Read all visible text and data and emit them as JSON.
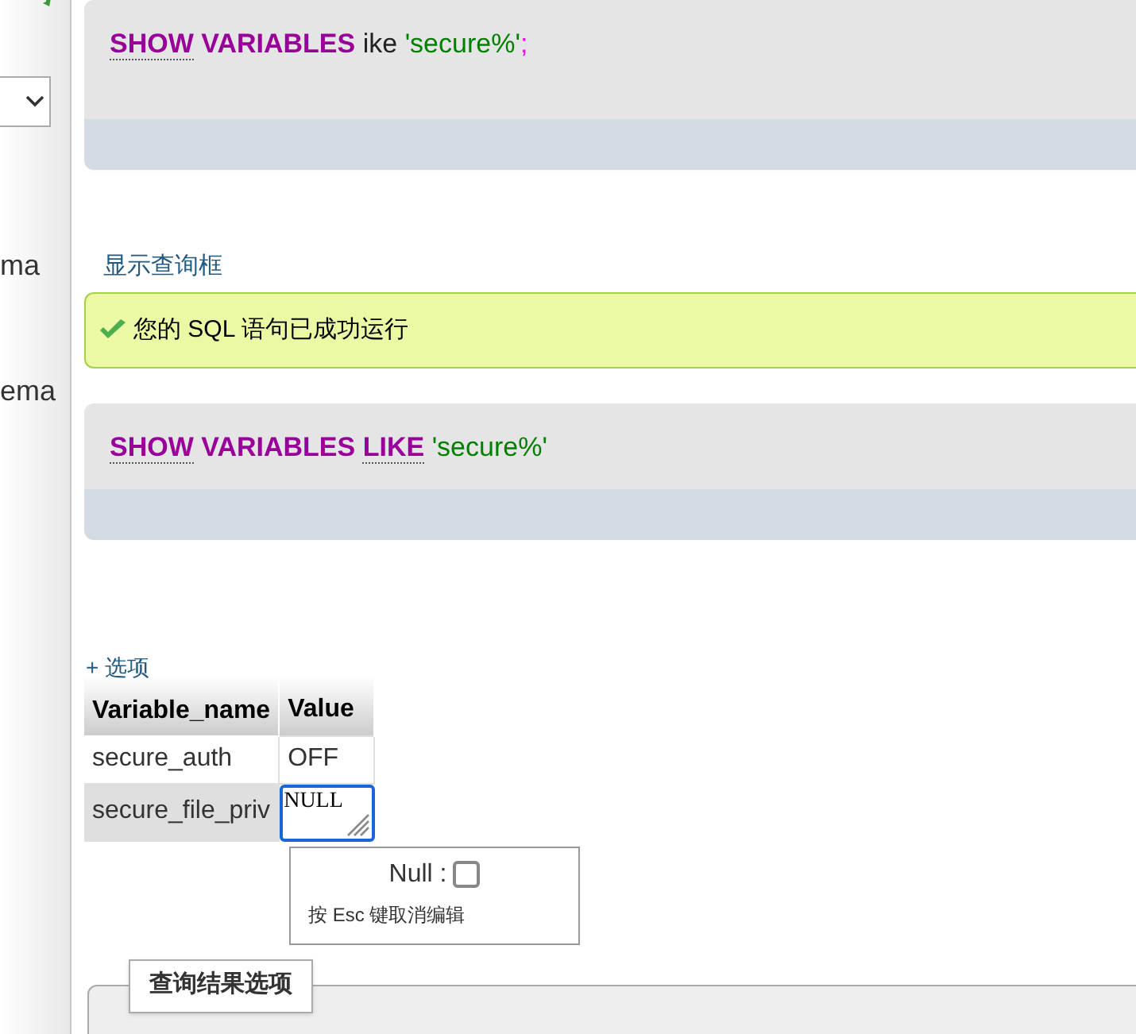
{
  "sidebar": {
    "items": [
      {
        "text": "ma"
      },
      {
        "text": "ema"
      }
    ]
  },
  "queries": [
    {
      "tokens": [
        {
          "text": "SHOW",
          "kind": "keyword",
          "linked": true
        },
        {
          "text": "VARIABLES",
          "kind": "keyword",
          "linked": false
        },
        {
          "text": "ike",
          "kind": "plain",
          "linked": false
        },
        {
          "text": "'secure%'",
          "kind": "string",
          "linked": false
        },
        {
          "text": ";",
          "kind": "punct",
          "linked": false
        }
      ]
    }
  ],
  "show_query_link": "显示查询框",
  "success_message": "您的 SQL 语句已成功运行",
  "executed_query": {
    "tokens": [
      {
        "text": "SHOW",
        "kind": "keyword",
        "linked": true
      },
      {
        "text": "VARIABLES",
        "kind": "keyword",
        "linked": false
      },
      {
        "text": "LIKE",
        "kind": "keyword",
        "linked": true
      },
      {
        "text": "'secure%'",
        "kind": "string",
        "linked": false
      }
    ]
  },
  "options_link": "+ 选项",
  "table": {
    "columns": [
      "Variable_name",
      "Value"
    ],
    "rows": [
      {
        "cells": [
          "secure_auth",
          "OFF"
        ],
        "editing": false
      },
      {
        "cells": [
          "secure_file_priv",
          "NULL"
        ],
        "editing": true
      }
    ]
  },
  "edit_popup": {
    "null_label": "Null :",
    "null_checked": false,
    "hint": "按 Esc 键取消编辑"
  },
  "result_options_button": "查询结果选项"
}
